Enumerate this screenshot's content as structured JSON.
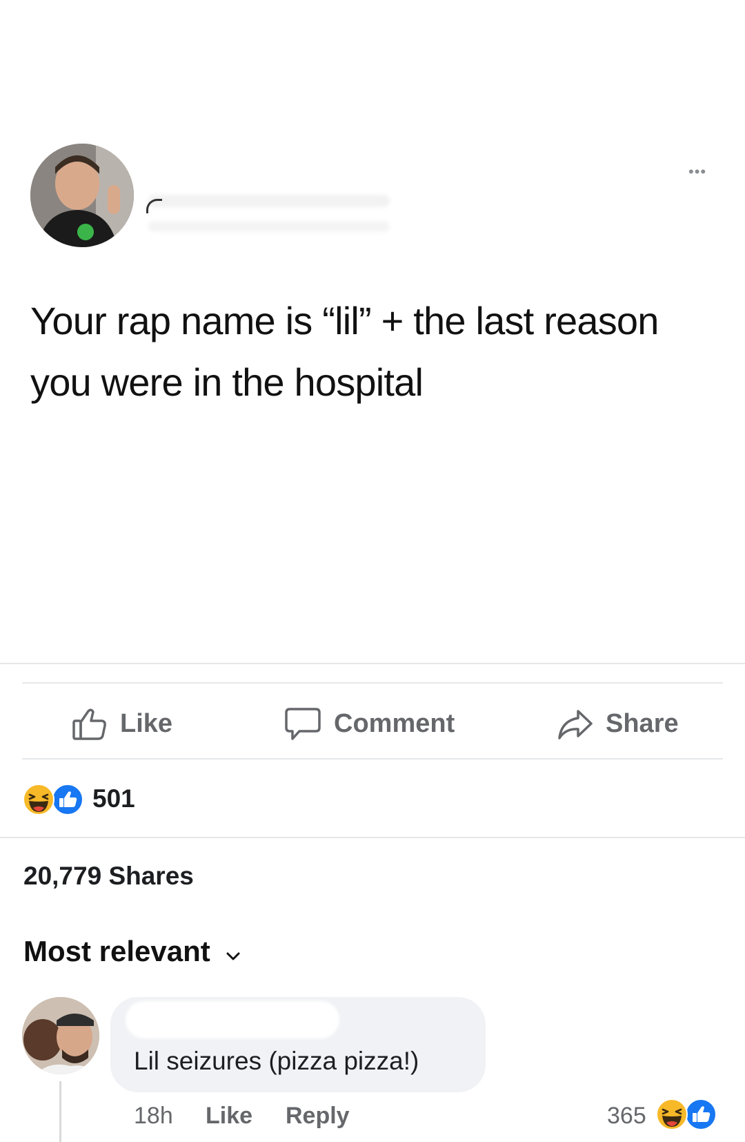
{
  "post": {
    "text": "Your rap name is “lil” + the last reason\nyou were in the hospital",
    "more_icon": "•••"
  },
  "actions": {
    "like": "Like",
    "comment": "Comment",
    "share": "Share"
  },
  "reactions": {
    "count": "501",
    "types": [
      "haha",
      "like"
    ]
  },
  "shares": {
    "text": "20,779 Shares"
  },
  "sort": {
    "label": "Most relevant"
  },
  "comment": {
    "text": "Lil seizures (pizza pizza!)",
    "time": "18h",
    "like": "Like",
    "reply": "Reply",
    "reaction_count": "365",
    "reaction_types": [
      "haha",
      "like"
    ]
  },
  "colors": {
    "like_blue": "#1877f2",
    "haha_yellow": "#f7b928",
    "secondary_text": "#65676b",
    "bubble_bg": "#f0f2f5"
  }
}
